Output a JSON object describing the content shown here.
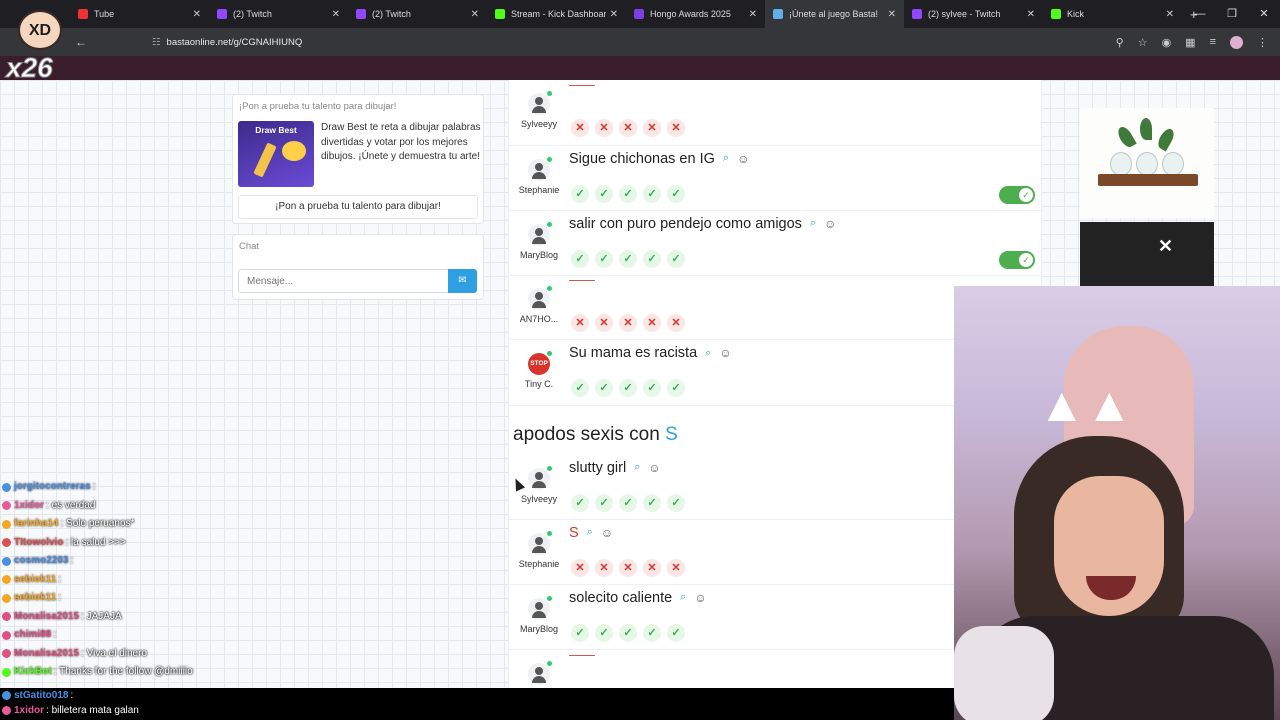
{
  "tabs": [
    {
      "title": "Tube",
      "color": "#e33"
    },
    {
      "title": "(2) Twitch",
      "color": "#9146ff"
    },
    {
      "title": "(2) Twitch",
      "color": "#9146ff"
    },
    {
      "title": "Stream - Kick Dashboard",
      "color": "#53fc18"
    },
    {
      "title": "Hongo Awards 2025",
      "color": "#7b3fe4"
    },
    {
      "title": "¡Únete al juego Basta!",
      "color": "#5fb0e8",
      "active": true
    },
    {
      "title": "(2) sylvee - Twitch",
      "color": "#9146ff"
    },
    {
      "title": "Kick",
      "color": "#53fc18"
    }
  ],
  "browser": {
    "url": "bastaonline.net/g/CGNAIHIUNQ",
    "new_tab": "+"
  },
  "promo": {
    "header": "¡Pon a prueba tu talento para dibujar!",
    "thumb_label": "Draw Best",
    "description": "Draw Best te reta a dibujar palabras divertidas y votar por los mejores dibujos. ¡Únete y demuestra tu arte!",
    "button": "¡Pon a prueba tu talento para dibujar!"
  },
  "chat": {
    "header": "Chat",
    "placeholder": "Mensaje..."
  },
  "answers": [
    {
      "user": "Sylveeyy",
      "text": "",
      "votes": [
        "no",
        "no",
        "no",
        "no",
        "no"
      ],
      "toggle": false
    },
    {
      "user": "Stephanie",
      "text": "Sigue chichonas en IG",
      "votes": [
        "ok",
        "ok",
        "ok",
        "ok",
        "ok"
      ],
      "toggle": true
    },
    {
      "user": "MaryBlog",
      "text": "salir con puro pendejo como amigos",
      "votes": [
        "ok",
        "ok",
        "ok",
        "ok",
        "ok"
      ],
      "toggle": true
    },
    {
      "user": "AN7HO...",
      "text": "",
      "votes": [
        "no",
        "no",
        "no",
        "no",
        "no"
      ],
      "toggle": false
    },
    {
      "user": "Tiny C.",
      "text": "Su mama es racista",
      "votes": [
        "ok",
        "ok",
        "ok",
        "ok",
        "ok"
      ],
      "toggle": false,
      "avatar": "stop"
    }
  ],
  "category": {
    "title": "apodos sexis con",
    "letter": "S"
  },
  "answers2": [
    {
      "user": "Sylveeyy",
      "text": "slutty girl",
      "votes": [
        "ok",
        "ok",
        "ok",
        "ok",
        "ok"
      ]
    },
    {
      "user": "Stephanie",
      "text": "S",
      "red": true,
      "votes": [
        "no",
        "no",
        "no",
        "no",
        "no"
      ]
    },
    {
      "user": "MaryBlog",
      "text": "solecito caliente",
      "votes": [
        "ok",
        "ok",
        "ok",
        "ok",
        "ok"
      ]
    },
    {
      "user": "",
      "text": "",
      "votes": []
    }
  ],
  "overlay": {
    "brand": "XD",
    "multiplier": "x26",
    "chat": [
      {
        "user": "jorgitocontreras",
        "color": "#4a90e2",
        "msg": ":"
      },
      {
        "user": "1xidor",
        "color": "#e85a9a",
        "msg": ": es verdad"
      },
      {
        "user": "farinha14",
        "color": "#f5a623",
        "msg": ": Solo peruanos*"
      },
      {
        "user": "TItowolvio",
        "color": "#e05050",
        "msg": ": la salud >>>"
      },
      {
        "user": "cosmo2203",
        "color": "#4a90e2",
        "msg": ":"
      },
      {
        "user": "sebiok11",
        "color": "#f5a623",
        "msg": ":"
      },
      {
        "user": "sebiok11",
        "color": "#f5a623",
        "msg": ":"
      },
      {
        "user": "Monalisa2015",
        "color": "#e05080",
        "msg": ": JAJAJA"
      },
      {
        "user": "chimi88",
        "color": "#e05080",
        "msg": ":"
      },
      {
        "user": "Monalisa2015",
        "color": "#e05080",
        "msg": ": Viva el dinero"
      },
      {
        "user": "KickBot",
        "color": "#53fc18",
        "msg": ": Thanks for the follow @dmiiiio"
      }
    ],
    "bottom_chat": [
      {
        "user": "stGatito018",
        "color": "#4a90e2",
        "msg": ":"
      },
      {
        "user": "1xidor",
        "color": "#e85a9a",
        "msg": ": billetera mata galan"
      }
    ]
  },
  "colors": {
    "accent": "#2e9fe0",
    "ok": "#2fb24c",
    "no": "#d9342b"
  }
}
